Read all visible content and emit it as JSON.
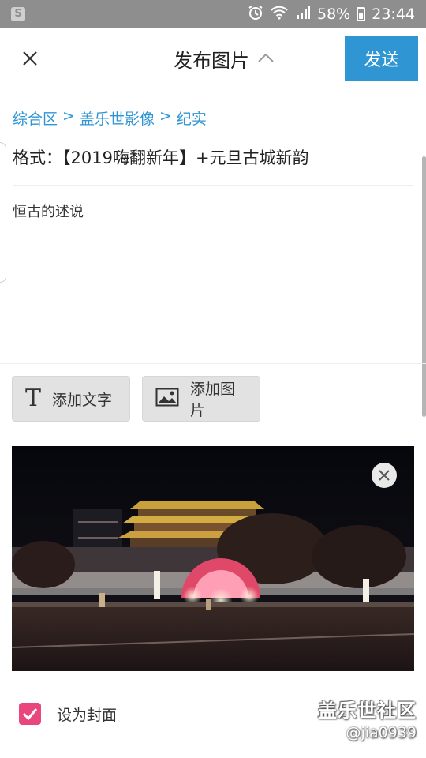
{
  "status_bar": {
    "battery_percent": "58%",
    "time": "23:44"
  },
  "header": {
    "title": "发布图片",
    "send_label": "发送"
  },
  "breadcrumb": {
    "items": [
      "综合区",
      ">",
      "盖乐世影像",
      ">",
      "纪实"
    ]
  },
  "post": {
    "title": "格式：【2019嗨翻新年】+元旦古城新韵",
    "body": "恒古的述说"
  },
  "toolbar": {
    "add_text_label": "添加文字",
    "add_image_label": "添加图片"
  },
  "cover": {
    "label": "设为封面",
    "checked": true
  },
  "watermark": {
    "logo_text": "盖乐世社区",
    "user": "@jia0939"
  },
  "colors": {
    "accent": "#2f96d3",
    "checkbox": "#e8467c",
    "status_bar": "#8e8e8e"
  }
}
